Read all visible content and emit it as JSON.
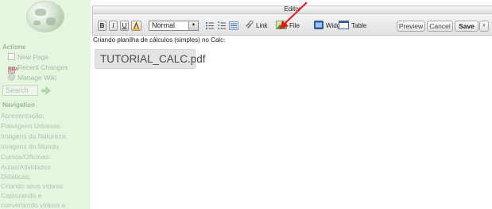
{
  "sidebar": {
    "actions_title": "Actions",
    "actions": [
      {
        "label": "New Page",
        "icon": "page-icon"
      },
      {
        "label": "Recent Changes",
        "icon": "changes-icon"
      },
      {
        "label": "Manage Wiki",
        "icon": "manage-icon"
      }
    ],
    "search_placeholder": "Search",
    "navigation_title": "Navigation",
    "nav_links": [
      "Apresentação:",
      "Paisagens Urbanas:",
      "Imagens da Natureza:",
      "Imagens do Mundo:",
      "Cursos/Oficinas:",
      "Aulas/Atividades",
      "Didáticas:",
      "Criando seus vídeos:",
      "Capturando e",
      "convertendo vídeos e"
    ]
  },
  "editor": {
    "title": "Editor",
    "toolbar": {
      "bold": "B",
      "italic": "I",
      "underline": "U",
      "format_value": "Normal",
      "link_label": "Link",
      "image_label": "File",
      "widget_label": "Widget",
      "table_label": "Table",
      "preview_label": "Preview",
      "cancel_label": "Cancel",
      "save_label": "Save"
    },
    "content_line": "Criando planilha de cálculos (simples) no Calc:",
    "attachment_label": "TUTORIAL_CALC.pdf"
  },
  "colors": {
    "sidebar_bg": "#e6f5df",
    "annotation_arrow": "#e0191b"
  }
}
